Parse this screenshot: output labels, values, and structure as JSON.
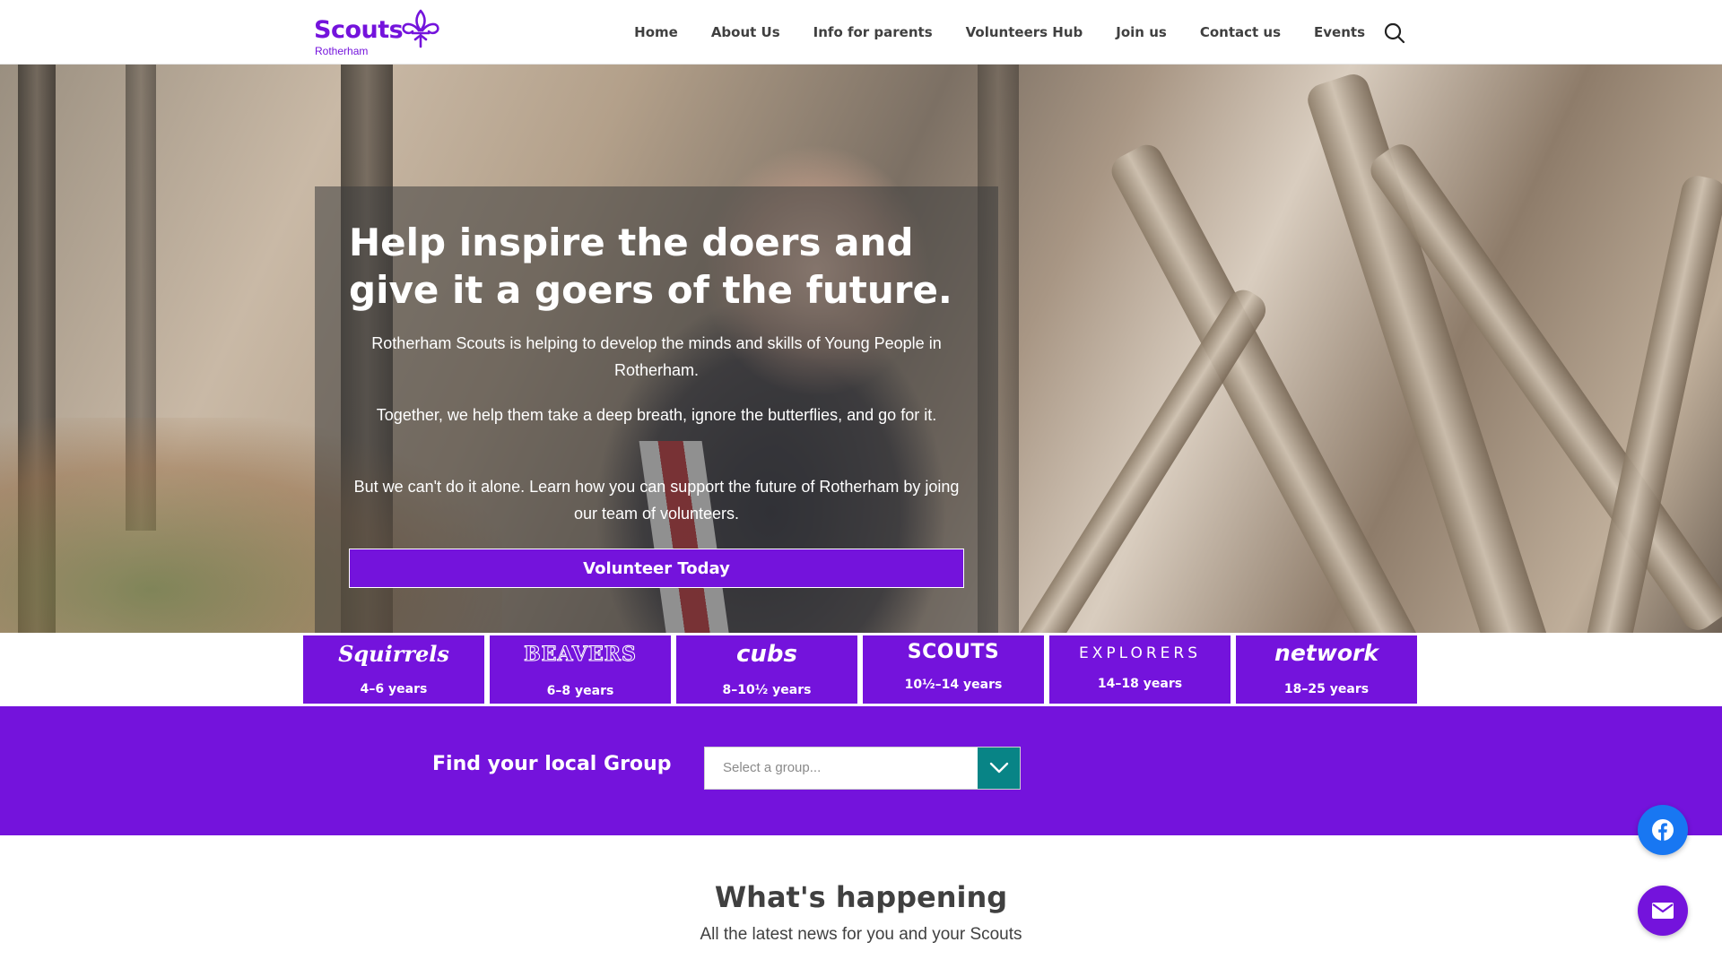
{
  "header": {
    "logo": {
      "name": "Scouts",
      "sub": "Rotherham"
    },
    "nav": [
      "Home",
      "About Us",
      "Info for parents",
      "Volunteers Hub",
      "Join us",
      "Contact us",
      "Events"
    ],
    "search_icon": "search-icon"
  },
  "hero": {
    "title": "Help inspire the doers and give it a goers of the future.",
    "paragraphs": [
      "Rotherham Scouts is helping to develop the minds and skills of Young People in Rotherham.",
      "Together, we help them take a deep breath, ignore the butterflies, and go for it.",
      "But we can't do it alone. Learn how you can support the future of Rotherham by joing our team of volunteers."
    ],
    "cta": "Volunteer Today"
  },
  "sections": [
    {
      "name": "Squirrels",
      "age": "4–6 years"
    },
    {
      "name": "BEAVERS",
      "age": "6–8 years"
    },
    {
      "name": "cubs",
      "age": "8–10½ years"
    },
    {
      "name": "SCOUTS",
      "age": "10½–14 years"
    },
    {
      "name": "EXPLORERS",
      "age": "14–18 years"
    },
    {
      "name": "network",
      "age": "18–25 years"
    }
  ],
  "find_group": {
    "label": "Find your local Group",
    "placeholder": "Select a group...",
    "arrow_icon": "chevron-down-icon"
  },
  "news": {
    "title": "What's happening",
    "subtitle": "All the latest news for you and your Scouts"
  },
  "floating": {
    "facebook_icon": "facebook-icon",
    "email_icon": "envelope-icon"
  },
  "colors": {
    "brand_purple": "#7413dc",
    "teal": "#088486",
    "facebook_blue": "#1877f2",
    "text_dark": "#404040"
  }
}
